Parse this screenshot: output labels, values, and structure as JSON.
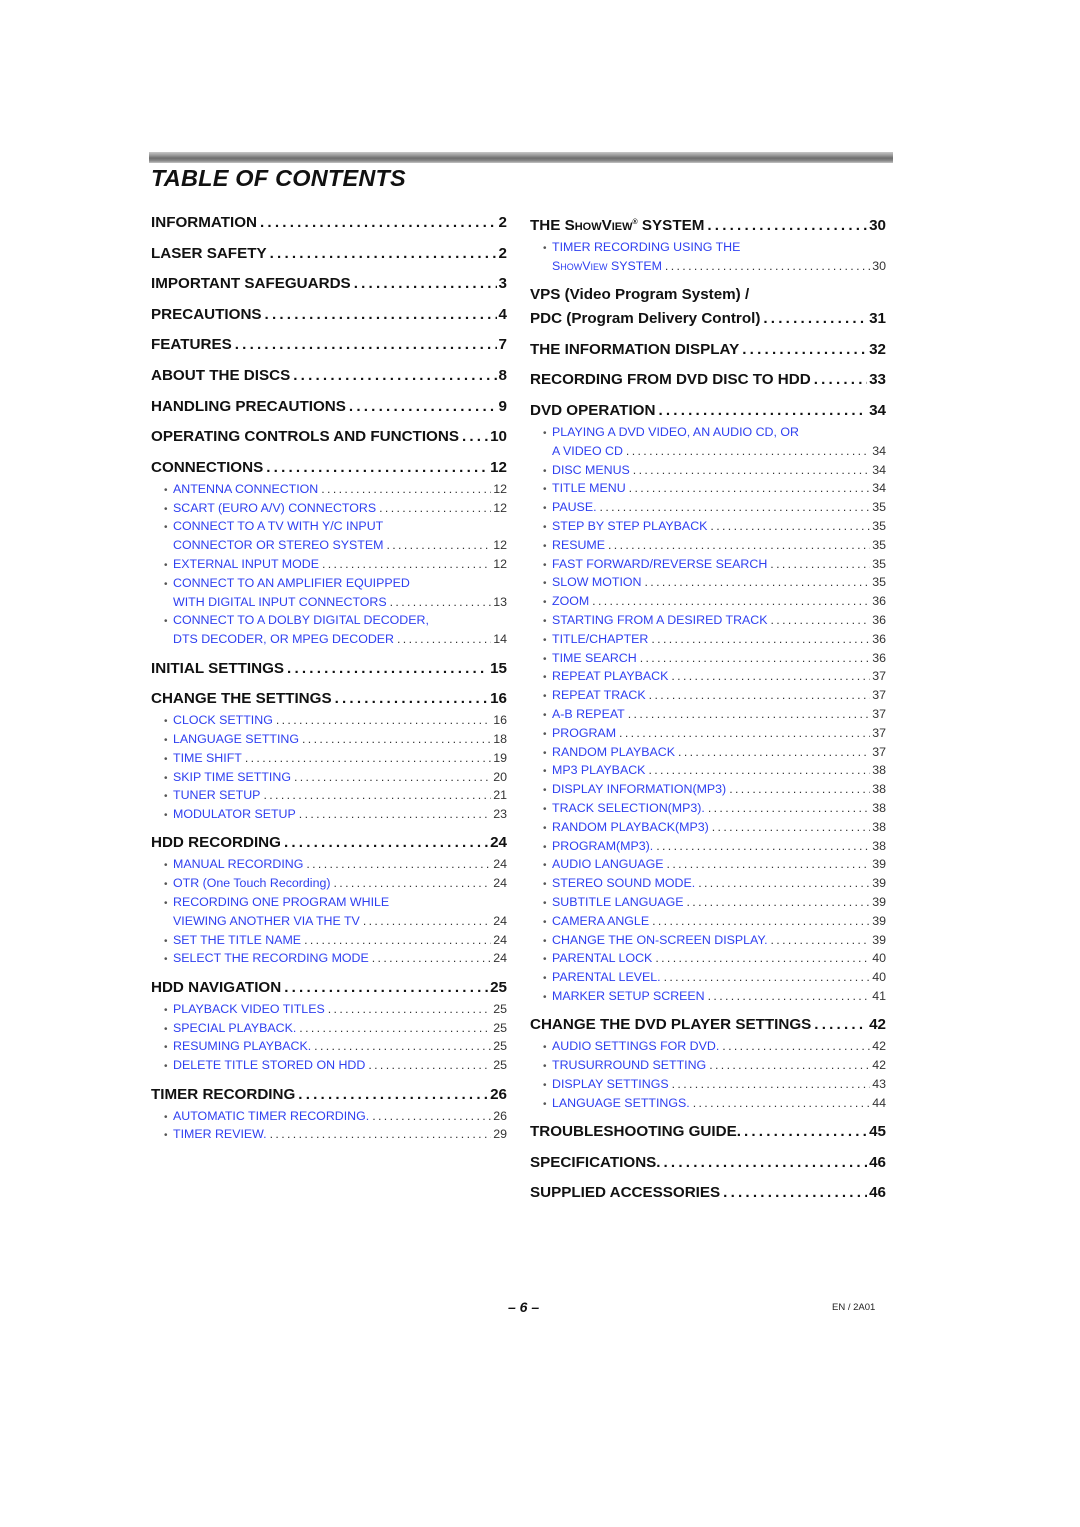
{
  "title": "TABLE OF CONTENTS",
  "colors": {
    "subentry_text": "#2e3ff0",
    "heading_text": "#111111"
  },
  "left_column": [
    {
      "label": "INFORMATION",
      "page": "2"
    },
    {
      "label": "LASER SAFETY",
      "page": "2"
    },
    {
      "label": "IMPORTANT SAFEGUARDS",
      "page": "3"
    },
    {
      "label": "PRECAUTIONS",
      "page": "4"
    },
    {
      "label": "FEATURES",
      "page": "7"
    },
    {
      "label": "ABOUT THE DISCS",
      "page": "8"
    },
    {
      "label": "HANDLING PRECAUTIONS",
      "page": "9"
    },
    {
      "label": "OPERATING CONTROLS AND FUNCTIONS",
      "page": "10"
    },
    {
      "label": "CONNECTIONS",
      "page": "12",
      "items": [
        {
          "label": "ANTENNA CONNECTION",
          "page": "12"
        },
        {
          "label": "SCART (EURO A/V) CONNECTORS",
          "page": "12"
        },
        {
          "label": "CONNECT TO A TV WITH Y/C INPUT",
          "label2": "CONNECTOR OR STEREO SYSTEM",
          "page": "12"
        },
        {
          "label": "EXTERNAL INPUT MODE",
          "page": "12"
        },
        {
          "label": "CONNECT TO AN AMPLIFIER EQUIPPED",
          "label2": "WITH DIGITAL INPUT CONNECTORS",
          "page": "13"
        },
        {
          "label": "CONNECT TO A DOLBY DIGITAL DECODER,",
          "label2": "DTS DECODER, OR MPEG DECODER",
          "page": "14"
        }
      ]
    },
    {
      "label": "INITIAL SETTINGS",
      "page": "15"
    },
    {
      "label": "CHANGE THE SETTINGS",
      "page": "16",
      "items": [
        {
          "label": "CLOCK SETTING",
          "page": "16"
        },
        {
          "label": "LANGUAGE SETTING",
          "page": "18"
        },
        {
          "label": "TIME SHIFT",
          "page": "19"
        },
        {
          "label": "SKIP TIME SETTING",
          "page": "20"
        },
        {
          "label": "TUNER SETUP",
          "page": "21"
        },
        {
          "label": "MODULATOR SETUP",
          "page": "23"
        }
      ]
    },
    {
      "label": "HDD RECORDING",
      "page": "24",
      "items": [
        {
          "label": "MANUAL RECORDING",
          "page": "24"
        },
        {
          "label": "OTR (One Touch Recording)",
          "page": "24"
        },
        {
          "label": "RECORDING ONE PROGRAM WHILE",
          "label2": "VIEWING ANOTHER VIA THE TV",
          "page": "24"
        },
        {
          "label": "SET THE TITLE NAME",
          "page": "24"
        },
        {
          "label": "SELECT THE RECORDING MODE",
          "page": "24"
        }
      ]
    },
    {
      "label": "HDD NAVIGATION",
      "page": "25",
      "items": [
        {
          "label": "PLAYBACK VIDEO TITLES",
          "page": "25"
        },
        {
          "label": "SPECIAL PLAYBACK.",
          "page": "25"
        },
        {
          "label": "RESUMING PLAYBACK.",
          "page": "25"
        },
        {
          "label": "DELETE TITLE STORED ON HDD",
          "page": "25"
        }
      ]
    },
    {
      "label": "TIMER RECORDING",
      "page": "26",
      "items": [
        {
          "label": "AUTOMATIC TIMER RECORDING.",
          "page": "26"
        },
        {
          "label": "TIMER REVIEW.",
          "page": "29"
        }
      ]
    }
  ],
  "right_column": [
    {
      "label_prefix": "THE ",
      "label_smallcaps": "ShowView",
      "label_reg": "®",
      "label_suffix": " SYSTEM",
      "page": "30",
      "items": [
        {
          "label": "TIMER RECORDING USING THE",
          "label2_smallcaps": "ShowView",
          "label2": " SYSTEM",
          "page": "30"
        }
      ]
    },
    {
      "label": "VPS (Video Program System) /",
      "label2": "PDC (Program Delivery Control)",
      "page": "31"
    },
    {
      "label": "THE INFORMATION DISPLAY",
      "page": "32"
    },
    {
      "label": "RECORDING FROM DVD DISC TO HDD",
      "page": "33"
    },
    {
      "label": "DVD OPERATION",
      "page": "34",
      "items": [
        {
          "label": "PLAYING A DVD VIDEO, AN AUDIO CD, OR",
          "label2": "A VIDEO CD",
          "page": "34"
        },
        {
          "label": "DISC MENUS",
          "page": "34"
        },
        {
          "label": "TITLE MENU",
          "page": "34"
        },
        {
          "label": "PAUSE.",
          "page": "35"
        },
        {
          "label": "STEP BY STEP PLAYBACK",
          "page": "35"
        },
        {
          "label": "RESUME",
          "page": "35"
        },
        {
          "label": "FAST FORWARD/REVERSE SEARCH",
          "page": "35"
        },
        {
          "label": "SLOW MOTION",
          "page": "35"
        },
        {
          "label": "ZOOM",
          "page": "36"
        },
        {
          "label": "STARTING FROM A DESIRED TRACK",
          "page": "36"
        },
        {
          "label": "TITLE/CHAPTER",
          "page": "36"
        },
        {
          "label": "TIME SEARCH",
          "page": "36"
        },
        {
          "label": "REPEAT PLAYBACK",
          "page": "37"
        },
        {
          "label": "REPEAT TRACK",
          "page": "37"
        },
        {
          "label": "A-B REPEAT",
          "page": "37"
        },
        {
          "label": "PROGRAM",
          "page": "37"
        },
        {
          "label": "RANDOM PLAYBACK",
          "page": "37"
        },
        {
          "label": "MP3 PLAYBACK",
          "page": "38"
        },
        {
          "label": "DISPLAY INFORMATION(MP3)",
          "page": "38"
        },
        {
          "label": "TRACK SELECTION(MP3).",
          "page": "38"
        },
        {
          "label": "RANDOM PLAYBACK(MP3)",
          "page": "38"
        },
        {
          "label": "PROGRAM(MP3).",
          "page": "38"
        },
        {
          "label": "AUDIO LANGUAGE",
          "page": "39"
        },
        {
          "label": "STEREO SOUND MODE.",
          "page": "39"
        },
        {
          "label": "SUBTITLE LANGUAGE",
          "page": "39"
        },
        {
          "label": "CAMERA ANGLE",
          "page": "39"
        },
        {
          "label": "CHANGE THE ON-SCREEN DISPLAY.",
          "page": "39"
        },
        {
          "label": "PARENTAL LOCK",
          "page": "40"
        },
        {
          "label": "PARENTAL LEVEL.",
          "page": "40"
        },
        {
          "label": "MARKER SETUP SCREEN",
          "page": "41"
        }
      ]
    },
    {
      "label": "CHANGE THE DVD PLAYER SETTINGS",
      "page": "42",
      "items": [
        {
          "label": "AUDIO SETTINGS FOR DVD.",
          "page": "42"
        },
        {
          "label": "TRUSURROUND SETTING",
          "page": "42"
        },
        {
          "label": "DISPLAY SETTINGS",
          "page": "43"
        },
        {
          "label": "LANGUAGE SETTINGS.",
          "page": "44"
        }
      ]
    },
    {
      "label": "TROUBLESHOOTING GUIDE.",
      "page": "45"
    },
    {
      "label": "SPECIFICATIONS.",
      "page": "46"
    },
    {
      "label": "SUPPLIED ACCESSORIES",
      "page": "46"
    }
  ],
  "footer": {
    "page_number": "– 6 –",
    "code": "EN / 2A01"
  }
}
